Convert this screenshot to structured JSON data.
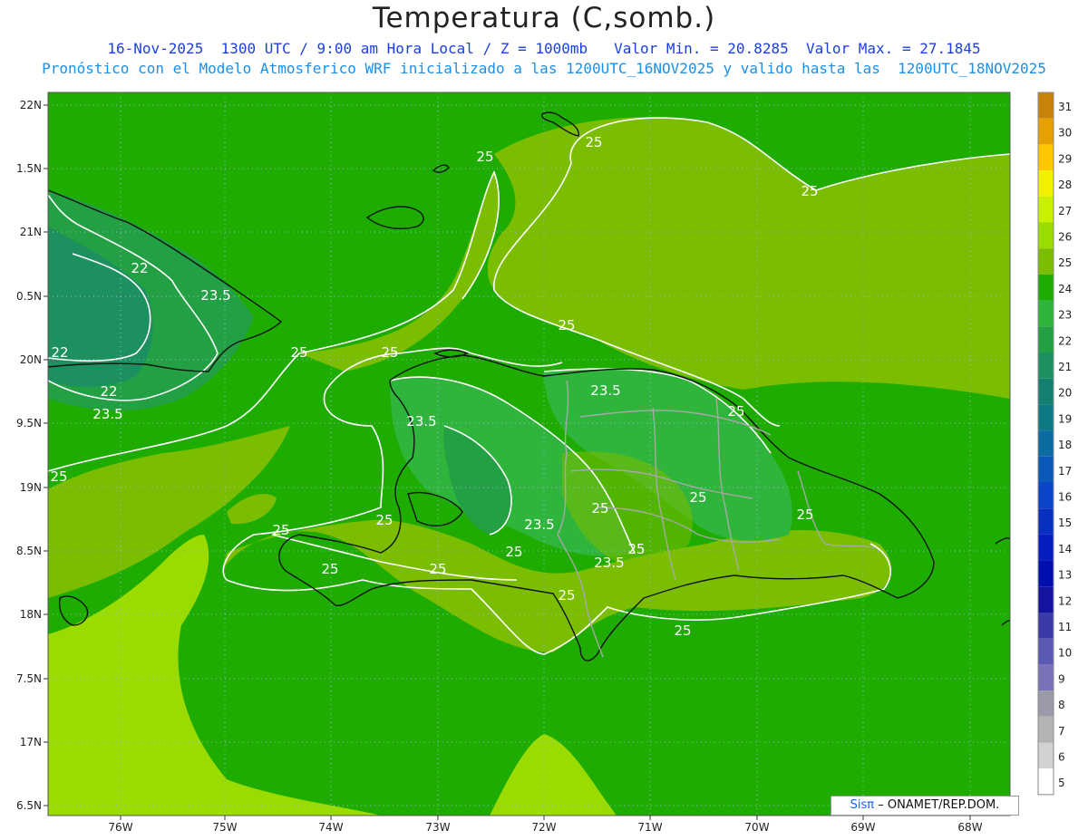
{
  "header": {
    "title": "Temperatura (C,somb.)",
    "subtitle1": "16-Nov-2025  1300 UTC / 9:00 am Hora Local / Z = 1000mb   Valor Min. = 20.8285  Valor Max. = 27.1845",
    "subtitle2": "Pronóstico con el Modelo Atmosferico WRF inicializado a las 1200UTC_16NOV2025 y valido hasta las  1200UTC_18NOV2025"
  },
  "axes": {
    "lat_labels": [
      "22N",
      "1.5N",
      "21N",
      "0.5N",
      "20N",
      "9.5N",
      "19N",
      "8.5N",
      "18N",
      "7.5N",
      "17N",
      "6.5N"
    ],
    "lon_labels": [
      "76W",
      "75W",
      "74W",
      "73W",
      "72W",
      "71W",
      "70W",
      "69W",
      "68W"
    ]
  },
  "colorbar": {
    "levels": [
      "31",
      "30",
      "29",
      "28",
      "27",
      "26",
      "25",
      "24",
      "23",
      "22",
      "21",
      "20",
      "19",
      "18",
      "17",
      "16",
      "15",
      "14",
      "13",
      "12",
      "11",
      "10",
      "9",
      "8",
      "7",
      "6",
      "5"
    ],
    "colors": [
      "#c8820a",
      "#e6a000",
      "#ffc800",
      "#f5f000",
      "#c8f000",
      "#9bdc00",
      "#7bbd00",
      "#1eac00",
      "#2fb43c",
      "#24a044",
      "#1d9060",
      "#138070",
      "#0d7a86",
      "#0a6ca0",
      "#0a58b8",
      "#0a44c8",
      "#0830c0",
      "#061ec0",
      "#0010b0",
      "#1414a0",
      "#3a3aa8",
      "#5a5ab4",
      "#7a72b8",
      "#9a9aa8",
      "#b4b4b4",
      "#d2d2d2",
      "#ffffff"
    ]
  },
  "contour_labels": [
    "25",
    "25",
    "25",
    "25",
    "25",
    "25",
    "25",
    "25",
    "25",
    "25",
    "25",
    "25",
    "25",
    "25",
    "25",
    "25",
    "25",
    "23.5",
    "23.5",
    "23.5",
    "23.5",
    "23.5",
    "23.5",
    "22",
    "22",
    "22"
  ],
  "credit": {
    "brand": "Sisπ",
    "text": "– ONAMET/REP.DOM."
  }
}
